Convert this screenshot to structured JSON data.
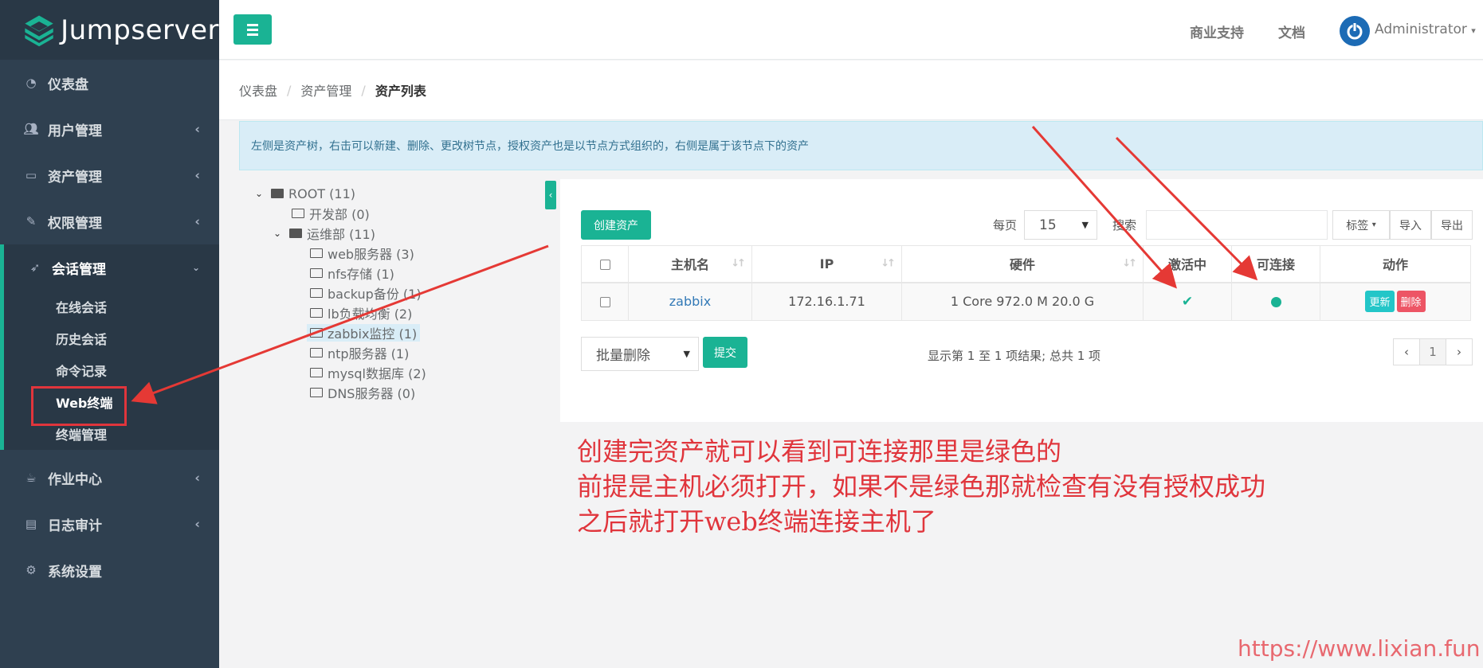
{
  "app": {
    "name": "Jumpserver"
  },
  "sidebar": {
    "items": [
      {
        "label": "仪表盘",
        "icon": "dashboard-icon"
      },
      {
        "label": "用户管理",
        "icon": "users-icon"
      },
      {
        "label": "资产管理",
        "icon": "inbox-icon"
      },
      {
        "label": "权限管理",
        "icon": "edit-icon"
      },
      {
        "label": "会话管理",
        "icon": "rocket-icon"
      },
      {
        "label": "作业中心",
        "icon": "coffee-icon"
      },
      {
        "label": "日志审计",
        "icon": "log-icon"
      },
      {
        "label": "系统设置",
        "icon": "gears-icon"
      }
    ],
    "session_sub": [
      "在线会话",
      "历史会话",
      "命令记录",
      "Web终端",
      "终端管理"
    ]
  },
  "header": {
    "links": [
      "商业支持",
      "文档"
    ],
    "user": "Administrator"
  },
  "breadcrumb": [
    "仪表盘",
    "资产管理",
    "资产列表"
  ],
  "alert": "左侧是资产树，右击可以新建、删除、更改树节点，授权资产也是以节点方式组织的，右侧是属于该节点下的资产",
  "tree": {
    "root": "ROOT (11)",
    "dev": "开发部 (0)",
    "ops": "运维部 (11)",
    "children": [
      "web服务器 (3)",
      "nfs存储 (1)",
      "backup备份 (1)",
      "lb负载均衡 (2)",
      "zabbix监控 (1)",
      "ntp服务器 (1)",
      "mysql数据库 (2)",
      "DNS服务器 (0)"
    ],
    "selected": "zabbix监控 (1)"
  },
  "toolbar": {
    "create": "创建资产",
    "per_page_label": "每页",
    "per_page_value": "15",
    "search_label": "搜索",
    "tags": "标签",
    "import": "导入",
    "export": "导出"
  },
  "table": {
    "headers": [
      "主机名",
      "IP",
      "硬件",
      "激活中",
      "可连接",
      "动作"
    ],
    "rows": [
      {
        "hostname": "zabbix",
        "ip": "172.16.1.71",
        "hardware": "1 Core 972.0 M 20.0 G",
        "active": true,
        "connectable": true
      }
    ],
    "update_btn": "更新",
    "delete_btn": "删除"
  },
  "bulk": {
    "select_value": "批量删除",
    "submit": "提交"
  },
  "pagination": {
    "info": "显示第 1 至 1 项结果; 总共 1 项",
    "prev": "‹",
    "page": "1",
    "next": "›"
  },
  "annotation": {
    "lines": [
      "创建完资产就可以看到可连接那里是绿色的",
      "前提是主机必须打开，如果不是绿色那就检查有没有授权成功",
      "之后就打开web终端连接主机了"
    ]
  },
  "watermark": "https://www.lixian.fun",
  "colors": {
    "primary": "#1ab394",
    "sidebar": "#2f4050",
    "info": "#23c6c8",
    "danger": "#ed5565",
    "annotation": "#e0353c"
  }
}
